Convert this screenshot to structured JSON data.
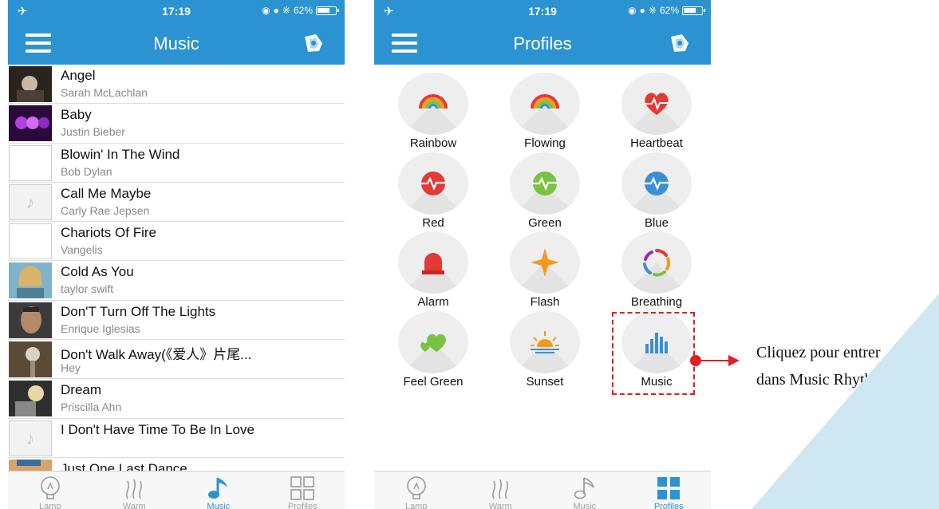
{
  "left_phone": {
    "status": {
      "time": "17:19",
      "battery": "62%"
    },
    "title": "Music",
    "songs": [
      {
        "title": "Angel",
        "artist": "Sarah McLachlan",
        "thumb": "album-art"
      },
      {
        "title": "Baby",
        "artist": "Justin Bieber",
        "thumb": "album-art"
      },
      {
        "title": "Blowin' In The Wind",
        "artist": "Bob Dylan",
        "thumb": "blank"
      },
      {
        "title": "Call Me Maybe",
        "artist": "Carly Rae Jepsen",
        "thumb": "music-note"
      },
      {
        "title": "Chariots Of Fire",
        "artist": "Vangelis",
        "thumb": "blank"
      },
      {
        "title": "Cold As You",
        "artist": "taylor swift",
        "thumb": "album-art"
      },
      {
        "title": "Don'T Turn Off The Lights",
        "artist": "Enrique Iglesias",
        "thumb": "album-art"
      },
      {
        "title": "Don't Walk Away(《爱人》片尾...",
        "artist": "Hey",
        "thumb": "album-art"
      },
      {
        "title": "Dream",
        "artist": "Priscilla Ahn",
        "thumb": "album-art"
      },
      {
        "title": "I Don't Have Time To Be In Love",
        "artist": "",
        "thumb": "music-note"
      },
      {
        "title": "Just One Last Dance",
        "artist": "",
        "thumb": "album-art"
      }
    ],
    "tabs": [
      {
        "label": "Lamp",
        "icon": "bulb-icon"
      },
      {
        "label": "Warm",
        "icon": "steam-icon"
      },
      {
        "label": "Music",
        "icon": "music-note-icon"
      },
      {
        "label": "Profiles",
        "icon": "grid-icon"
      }
    ],
    "active_tab": "Music"
  },
  "right_phone": {
    "status": {
      "time": "17:19",
      "battery": "62%"
    },
    "title": "Profiles",
    "profiles": [
      {
        "label": "Rainbow",
        "icon": "rainbow-icon"
      },
      {
        "label": "Flowing",
        "icon": "rainbow-icon"
      },
      {
        "label": "Heartbeat",
        "icon": "heart-pulse-icon"
      },
      {
        "label": "Red",
        "icon": "pulse-icon"
      },
      {
        "label": "Green",
        "icon": "pulse-icon"
      },
      {
        "label": "Blue",
        "icon": "pulse-icon"
      },
      {
        "label": "Alarm",
        "icon": "alarm-light-icon"
      },
      {
        "label": "Flash",
        "icon": "star-flash-icon"
      },
      {
        "label": "Breathing",
        "icon": "color-wheel-icon"
      },
      {
        "label": "Feel Green",
        "icon": "green-hearts-icon"
      },
      {
        "label": "Sunset",
        "icon": "sunset-icon"
      },
      {
        "label": "Music",
        "icon": "bars-icon"
      }
    ],
    "tabs": [
      {
        "label": "Lamp",
        "icon": "bulb-icon"
      },
      {
        "label": "Warm",
        "icon": "steam-icon"
      },
      {
        "label": "Music",
        "icon": "music-note-icon"
      },
      {
        "label": "Profiles",
        "icon": "grid-icon"
      }
    ],
    "active_tab": "Profiles"
  },
  "annotation": {
    "line1": "Cliquez pour entrer",
    "line2": "dans Music Rhythm"
  },
  "colors": {
    "accent": "#2c93d3",
    "annotation_red": "#e02020",
    "red_icon": "#e53935",
    "green_icon": "#7cc242",
    "blue_icon": "#3a8fd4",
    "orange_icon": "#f39a1e"
  }
}
